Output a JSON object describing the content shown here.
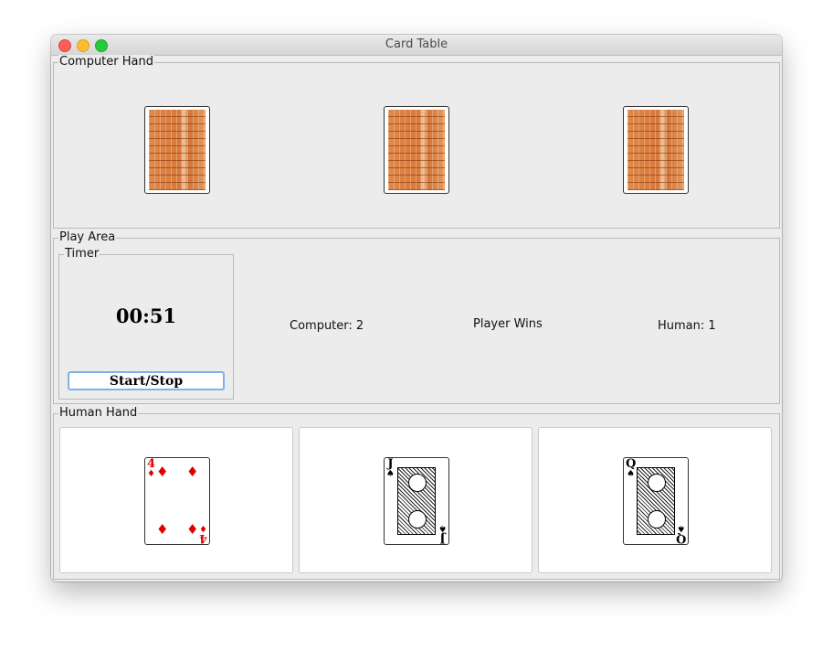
{
  "window": {
    "title": "Card Table"
  },
  "computer_hand": {
    "legend": "Computer Hand",
    "card_count": 3
  },
  "play_area": {
    "legend": "Play Area",
    "timer": {
      "legend": "Timer",
      "time": "00:51",
      "button_label": "Start/Stop"
    },
    "computer_score": "Computer: 2",
    "result": "Player Wins",
    "human_score": "Human: 1"
  },
  "human_hand": {
    "legend": "Human Hand",
    "cards": [
      {
        "rank": "4",
        "suit": "♦",
        "color": "#e00000"
      },
      {
        "rank": "J",
        "suit": "♠",
        "color": "#000000"
      },
      {
        "rank": "Q",
        "suit": "♠",
        "color": "#000000"
      }
    ]
  },
  "icons": {
    "close": "close-icon",
    "minimize": "minimize-icon",
    "maximize": "maximize-icon",
    "card_back": "card-back-icon"
  }
}
